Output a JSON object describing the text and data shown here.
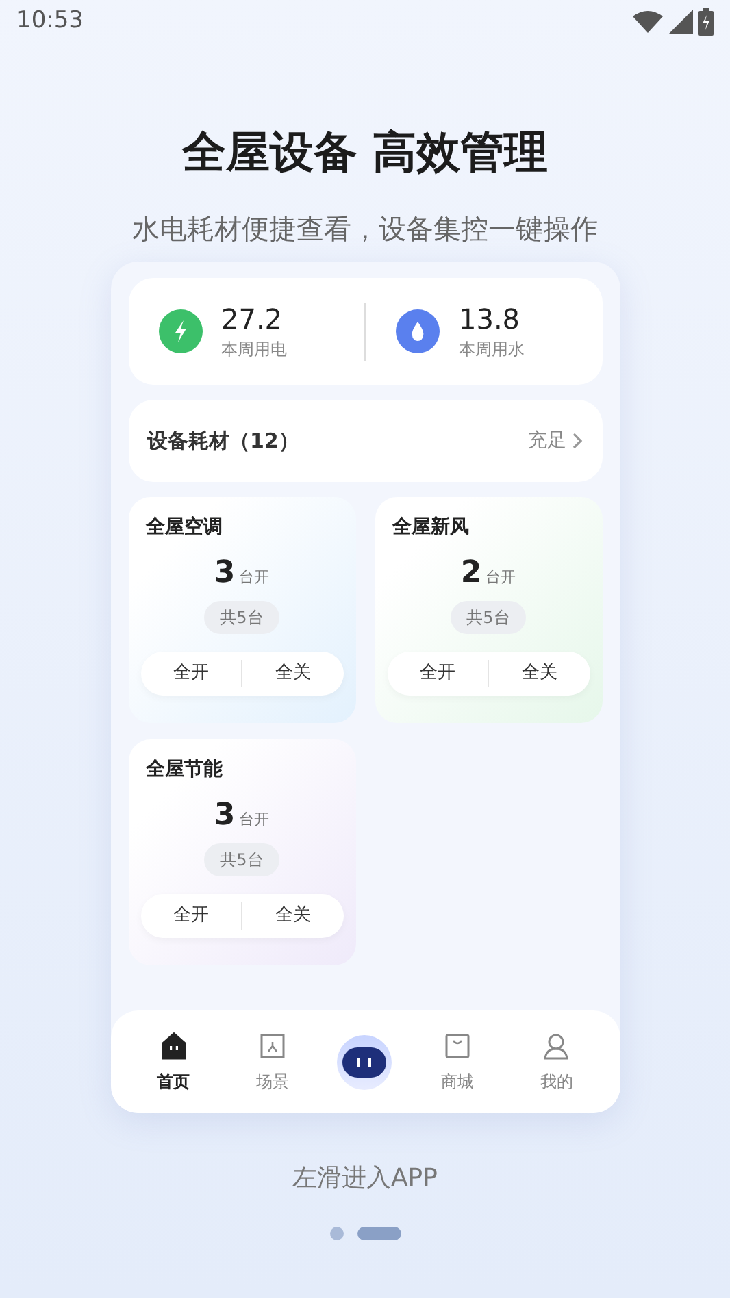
{
  "status_bar": {
    "time": "10:53"
  },
  "headline": "全屋设备 高效管理",
  "subtitle": "水电耗材便捷查看，设备集控一键操作",
  "usage": [
    {
      "kind": "electric",
      "value": "27.2",
      "label": "本周用电"
    },
    {
      "kind": "water",
      "value": "13.8",
      "label": "本周用水"
    }
  ],
  "consumables": {
    "title": "设备耗材（12）",
    "status": "充足"
  },
  "groups": [
    {
      "title": "全屋空调",
      "count": "3",
      "unit": "台开",
      "total": "共5台",
      "color": "#e3f1fd",
      "buttons": [
        "全开",
        "全关"
      ]
    },
    {
      "title": "全屋新风",
      "count": "2",
      "unit": "台开",
      "total": "共5台",
      "color": "#e6f7ea",
      "buttons": [
        "全开",
        "全关"
      ]
    },
    {
      "title": "全屋节能",
      "count": "3",
      "unit": "台开",
      "total": "共5台",
      "color": "#efeafa",
      "buttons": [
        "全开",
        "全关"
      ]
    }
  ],
  "nav": [
    {
      "kind": "home",
      "label": "首页",
      "selected": true
    },
    {
      "kind": "scene",
      "label": "场景",
      "selected": false
    },
    {
      "kind": "robot"
    },
    {
      "kind": "shop",
      "label": "商城",
      "selected": false
    },
    {
      "kind": "profile",
      "label": "我的",
      "selected": false
    }
  ],
  "hint": "左滑进入APP",
  "pager": [
    {
      "selected": false
    },
    {
      "selected": true
    }
  ]
}
